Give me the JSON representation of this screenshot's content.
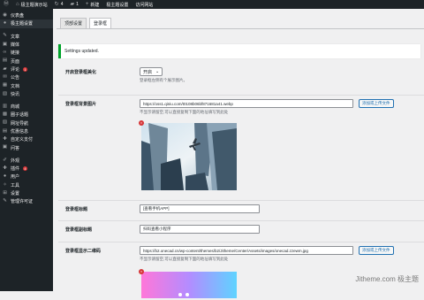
{
  "admin_bar": {
    "site_name": "极主题演示站",
    "updates": "4",
    "comments": "1",
    "new": "新建",
    "theme_settings": "极主题设置",
    "visit_site": "访问网站"
  },
  "sidebar": {
    "items": [
      {
        "label": "仪表盘",
        "icon": "dashboard-icon",
        "glyph": "◉"
      },
      {
        "label": "极主题设置",
        "icon": "settings-icon",
        "glyph": "●",
        "active": true
      },
      {
        "label": "文章",
        "icon": "pin-icon",
        "glyph": "✎"
      },
      {
        "label": "媒体",
        "icon": "media-icon",
        "glyph": "▣"
      },
      {
        "label": "链接",
        "icon": "link-icon",
        "glyph": "∞"
      },
      {
        "label": "页面",
        "icon": "page-icon",
        "glyph": "▤"
      },
      {
        "label": "评论",
        "icon": "comment-icon",
        "glyph": "▰",
        "badge": "1"
      },
      {
        "label": "公告",
        "icon": "announcement-icon",
        "glyph": "✉"
      },
      {
        "label": "文档",
        "icon": "document-icon",
        "glyph": "▦"
      },
      {
        "label": "快讯",
        "icon": "flash-icon",
        "glyph": "▧"
      },
      {
        "label": "商城",
        "icon": "shop-icon",
        "glyph": "▥"
      },
      {
        "label": "圈子话题",
        "icon": "circle-icon",
        "glyph": "▩"
      },
      {
        "label": "网址导航",
        "icon": "navigation-icon",
        "glyph": "▨"
      },
      {
        "label": "优惠信息",
        "icon": "coupon-icon",
        "glyph": "▤"
      },
      {
        "label": "自定义支付",
        "icon": "payment-icon",
        "glyph": "✚"
      },
      {
        "label": "问答",
        "icon": "qa-icon",
        "glyph": "▣"
      },
      {
        "label": "外观",
        "icon": "appearance-icon",
        "glyph": "✐"
      },
      {
        "label": "插件",
        "icon": "plugin-icon",
        "glyph": "✚",
        "badge": "4"
      },
      {
        "label": "用户",
        "icon": "user-icon",
        "glyph": "●"
      },
      {
        "label": "工具",
        "icon": "tools-icon",
        "glyph": "✧"
      },
      {
        "label": "设置",
        "icon": "settings-gear-icon",
        "glyph": "⊞"
      },
      {
        "label": "管理许可证",
        "icon": "license-icon",
        "glyph": "✎"
      }
    ]
  },
  "tabs": [
    "顶部设置",
    "登录框"
  ],
  "notice": "Settings updated.",
  "form": {
    "beautify": {
      "label": "开启登录框美化",
      "value": "开启",
      "desc": "登录框左侧有个展示图片。"
    },
    "bg_image": {
      "label": "登录框背景图片",
      "value": "https://oss1.qiniu.com/t0108b06bf871681a41.webp",
      "button": "添加或上传文件",
      "desc": "不显示请留空,可以直接复制下面的地址填写到此处"
    },
    "title": {
      "label": "登录框标题",
      "value": "[查看手机APP]"
    },
    "subtitle": {
      "label": "登录框副标题",
      "value": "扫码查看小程序"
    },
    "qrcode": {
      "label": "登录框显示二维码",
      "value": "https://b2.onecad.cn/wp-content/themes/b2/Jitheme/Center/Assets/images/onecad.zzewm.jpg",
      "button": "添加或上传文件",
      "desc": "不显示请留空,可以直接复制下面的地址填写到此处"
    }
  },
  "watermark": "Jitheme.com 极主题",
  "colors": {
    "sidebar": "#1d2327",
    "accent": "#2271b1",
    "success": "#00a32a",
    "badge": "#d63638"
  }
}
